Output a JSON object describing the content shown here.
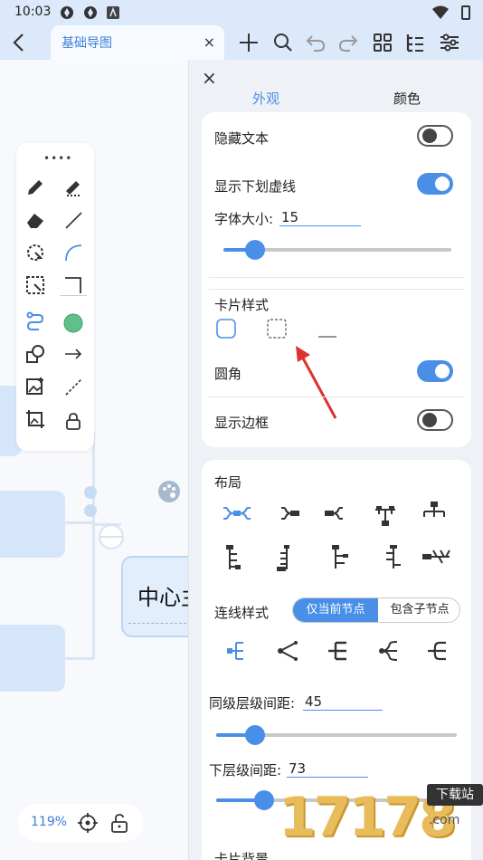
{
  "status_bar": {
    "time": "10:03"
  },
  "toolbar": {
    "tab_title": "基础导图",
    "tab_close": "×"
  },
  "canvas": {
    "central_node": "中心主",
    "zoom": "119%"
  },
  "panel": {
    "close": "×",
    "tabs": [
      {
        "label": "外观",
        "active": true
      },
      {
        "label": "颜色",
        "active": false
      }
    ],
    "appearance": {
      "hide_text": {
        "label": "隐藏文本",
        "on": false
      },
      "show_underline": {
        "label": "显示下划虚线",
        "on": true
      },
      "font_size": {
        "label": "字体大小:",
        "value": "15",
        "slider": 0.14
      },
      "card_style": {
        "label": "卡片样式"
      },
      "rounded": {
        "label": "圆角",
        "on": true
      },
      "show_border": {
        "label": "显示边框",
        "on": false
      }
    },
    "layout": {
      "label": "布局",
      "line_style": {
        "label": "连线样式",
        "options": [
          "仅当前节点",
          "包含子节点"
        ],
        "selected": "仅当前节点"
      },
      "sibling_spacing": {
        "label": "同级层级间距:",
        "value": "45",
        "slider": 0.16
      },
      "child_spacing": {
        "label": "下层级间距:",
        "value": "73",
        "slider": 0.2
      },
      "card_background": {
        "label": "卡片背景"
      }
    }
  },
  "watermark": {
    "digits": "17178",
    "tag1": "下载站",
    "tag2": ".com"
  },
  "colors": {
    "accent": "#4a8fe7",
    "toolbar_bg": "#dce9fa",
    "node": "#d5e6fb"
  }
}
